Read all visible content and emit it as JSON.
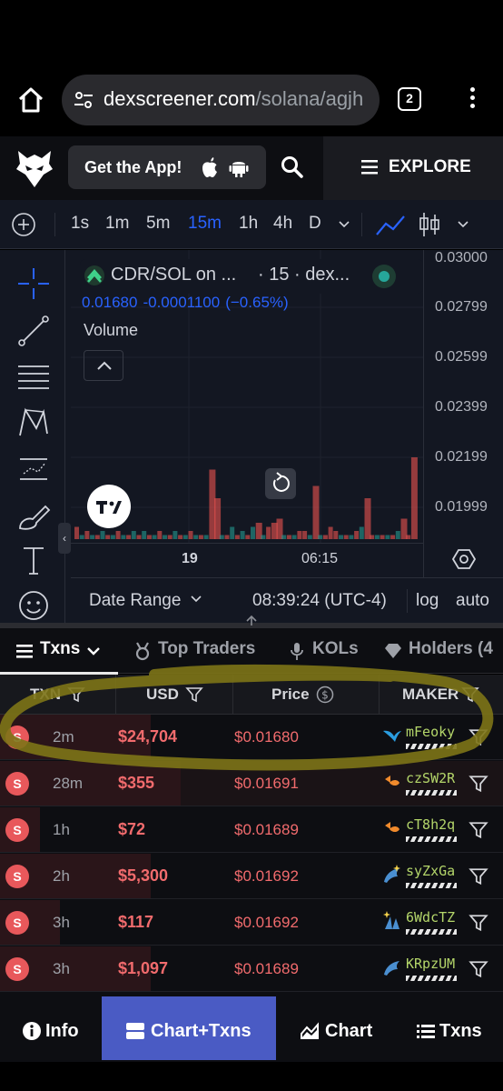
{
  "browser": {
    "url_host": "dexscreener.com",
    "url_path": "/solana/agjh",
    "tab_count": "2"
  },
  "header": {
    "get_app_label": "Get the App!",
    "explore_label": "EXPLORE"
  },
  "toolbar": {
    "timeframes": [
      "1s",
      "1m",
      "5m",
      "15m",
      "1h",
      "4h",
      "D"
    ],
    "active_timeframe": "15m"
  },
  "chart": {
    "pair_title": "CDR/SOL on ...",
    "pair_meta": "· 15 · dex...",
    "last_price": "0.01680",
    "change_abs": "-0.0001100",
    "change_pct": "(−0.65%)",
    "indicator_label": "Volume",
    "price_labels": [
      "0.03000",
      "0.02799",
      "0.02599",
      "0.02399",
      "0.02199",
      "0.01999"
    ],
    "time_labels": [
      "19",
      "06:15"
    ],
    "date_range_label": "Date Range",
    "clock": "08:39:24 (UTC-4)",
    "log_label": "log",
    "auto_label": "auto",
    "colors": {
      "up": "#26a69a",
      "down": "#ef5350",
      "accent": "#2962ff"
    },
    "volume_bars": [
      {
        "v": 3,
        "dir": "down"
      },
      {
        "v": 1,
        "dir": "up"
      },
      {
        "v": 2,
        "dir": "down"
      },
      {
        "v": 1,
        "dir": "up"
      },
      {
        "v": 1,
        "dir": "down"
      },
      {
        "v": 2,
        "dir": "up"
      },
      {
        "v": 1,
        "dir": "down"
      },
      {
        "v": 1,
        "dir": "up"
      },
      {
        "v": 2,
        "dir": "down"
      },
      {
        "v": 1,
        "dir": "up"
      },
      {
        "v": 1,
        "dir": "down"
      },
      {
        "v": 2,
        "dir": "up"
      },
      {
        "v": 1,
        "dir": "down"
      },
      {
        "v": 2,
        "dir": "up"
      },
      {
        "v": 1,
        "dir": "down"
      },
      {
        "v": 1,
        "dir": "up"
      },
      {
        "v": 2,
        "dir": "down"
      },
      {
        "v": 1,
        "dir": "up"
      },
      {
        "v": 1,
        "dir": "down"
      },
      {
        "v": 2,
        "dir": "up"
      },
      {
        "v": 1,
        "dir": "down"
      },
      {
        "v": 1,
        "dir": "up"
      },
      {
        "v": 2,
        "dir": "down"
      },
      {
        "v": 1,
        "dir": "up"
      },
      {
        "v": 1,
        "dir": "down"
      },
      {
        "v": 1,
        "dir": "up"
      },
      {
        "v": 17,
        "dir": "down"
      },
      {
        "v": 10,
        "dir": "down"
      },
      {
        "v": 1,
        "dir": "up"
      },
      {
        "v": 1,
        "dir": "down"
      },
      {
        "v": 3,
        "dir": "up"
      },
      {
        "v": 1,
        "dir": "down"
      },
      {
        "v": 2,
        "dir": "up"
      },
      {
        "v": 1,
        "dir": "down"
      },
      {
        "v": 3,
        "dir": "up"
      },
      {
        "v": 4,
        "dir": "down"
      },
      {
        "v": 1,
        "dir": "up"
      },
      {
        "v": 3,
        "dir": "down"
      },
      {
        "v": 4,
        "dir": "down"
      },
      {
        "v": 5,
        "dir": "down"
      },
      {
        "v": 1,
        "dir": "up"
      },
      {
        "v": 1,
        "dir": "down"
      },
      {
        "v": 1,
        "dir": "up"
      },
      {
        "v": 2,
        "dir": "down"
      },
      {
        "v": 2,
        "dir": "down"
      },
      {
        "v": 1,
        "dir": "up"
      },
      {
        "v": 13,
        "dir": "down"
      },
      {
        "v": 1,
        "dir": "up"
      },
      {
        "v": 1,
        "dir": "down"
      },
      {
        "v": 3,
        "dir": "down"
      },
      {
        "v": 2,
        "dir": "down"
      },
      {
        "v": 1,
        "dir": "up"
      },
      {
        "v": 1,
        "dir": "down"
      },
      {
        "v": 1,
        "dir": "up"
      },
      {
        "v": 2,
        "dir": "down"
      },
      {
        "v": 3,
        "dir": "up"
      },
      {
        "v": 10,
        "dir": "down"
      },
      {
        "v": 1,
        "dir": "down"
      },
      {
        "v": 1,
        "dir": "up"
      },
      {
        "v": 1,
        "dir": "down"
      },
      {
        "v": 1,
        "dir": "up"
      },
      {
        "v": 1,
        "dir": "down"
      },
      {
        "v": 2,
        "dir": "up"
      },
      {
        "v": 5,
        "dir": "down"
      },
      {
        "v": 1,
        "dir": "down"
      },
      {
        "v": 20,
        "dir": "down"
      }
    ]
  },
  "tabs": {
    "txns": "Txns",
    "top_traders": "Top Traders",
    "kols": "KOLs",
    "holders": "Holders (4"
  },
  "table": {
    "headers": {
      "txn": "TXN",
      "usd": "USD",
      "price": "Price",
      "maker": "MAKER"
    },
    "rows": [
      {
        "side": "S",
        "age": "2m",
        "usd": "$24,704",
        "price": "$0.01680",
        "maker": "mFeoky",
        "maker_icon": "bird-icon",
        "usd_fill": 0.3
      },
      {
        "side": "S",
        "age": "28m",
        "usd": "$355",
        "price": "$0.01691",
        "maker": "czSW2R",
        "maker_icon": "fish-icon",
        "usd_fill": 0.36
      },
      {
        "side": "S",
        "age": "1h",
        "usd": "$72",
        "price": "$0.01689",
        "maker": "cT8h2q",
        "maker_icon": "fish-icon",
        "usd_fill": 0.08
      },
      {
        "side": "S",
        "age": "2h",
        "usd": "$5,300",
        "price": "$0.01692",
        "maker": "syZxGa",
        "maker_icon": "dolphin-sparkle-icon",
        "usd_fill": 0.3
      },
      {
        "side": "S",
        "age": "3h",
        "usd": "$117",
        "price": "$0.01692",
        "maker": "6WdcTZ",
        "maker_icon": "shell-sparkle-icon",
        "usd_fill": 0.12
      },
      {
        "side": "S",
        "age": "3h",
        "usd": "$1,097",
        "price": "$0.01689",
        "maker": "KRpzUM",
        "maker_icon": "dolphin-icon",
        "usd_fill": 0.3
      }
    ]
  },
  "bottom_nav": {
    "info": "Info",
    "chart_txns": "Chart+Txns",
    "chart": "Chart",
    "txns": "Txns"
  }
}
